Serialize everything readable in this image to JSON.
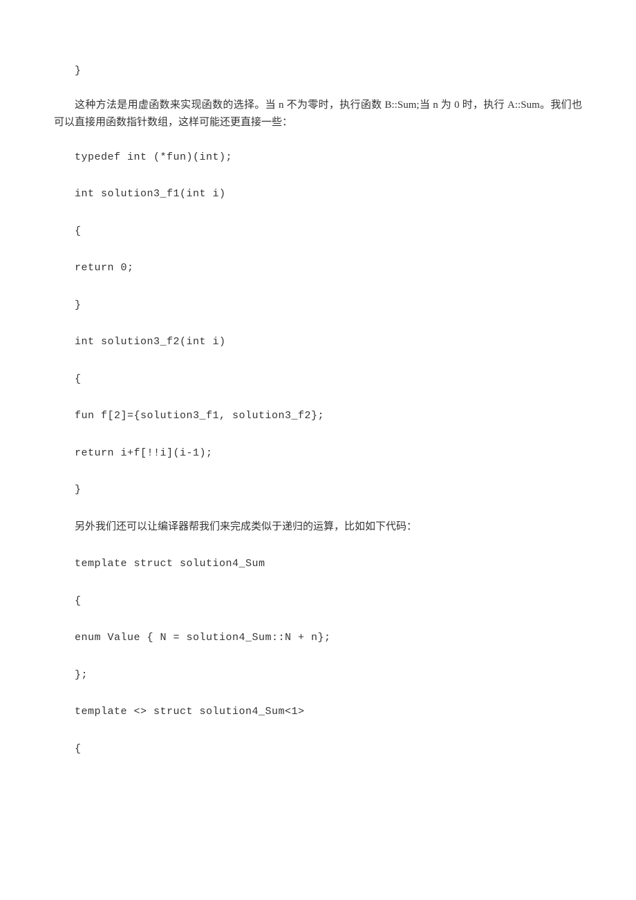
{
  "lines": {
    "l0": "}",
    "p1": "这种方法是用虚函数来实现函数的选择。当 n 不为零时，执行函数 B::Sum;当 n 为 0 时，执行 A::Sum。我们也可以直接用函数指针数组，这样可能还更直接一些：",
    "l2": "typedef int (*fun)(int);",
    "l3": "int solution3_f1(int i)",
    "l4": "{",
    "l5": "return 0;",
    "l6": "}",
    "l7": "int solution3_f2(int i)",
    "l8": "{",
    "l9": "fun f[2]={solution3_f1, solution3_f2};",
    "l10": "return i+f[!!i](i-1);",
    "l11": "}",
    "p2": "另外我们还可以让编译器帮我们来完成类似于递归的运算，比如如下代码：",
    "l13": "template struct solution4_Sum",
    "l14": "{",
    "l15": "enum Value { N = solution4_Sum::N + n};",
    "l16": "};",
    "l17": "template <> struct solution4_Sum<1>",
    "l18": "{"
  }
}
